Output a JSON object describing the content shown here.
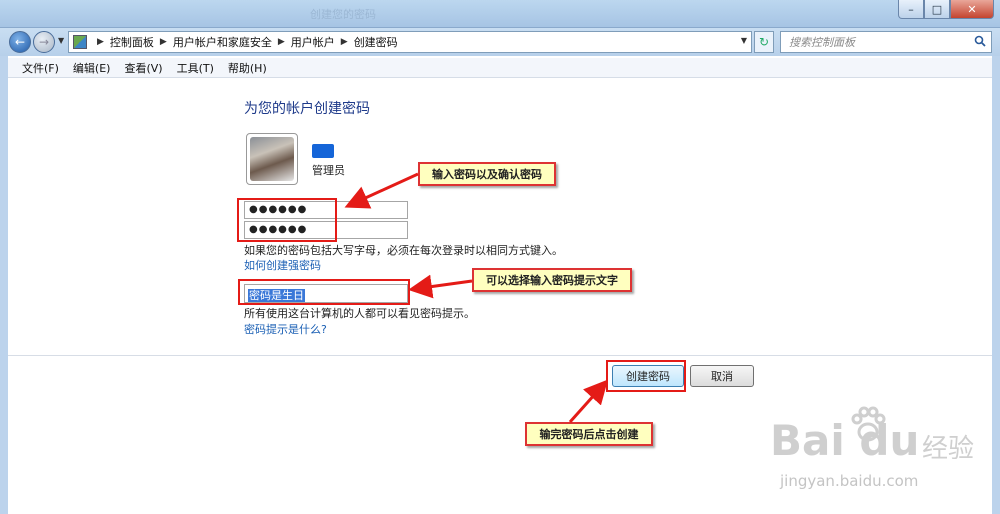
{
  "window": {
    "title": "创建您的密码"
  },
  "address": {
    "crumbs": [
      "控制面板",
      "用户帐户和家庭安全",
      "用户帐户",
      "创建密码"
    ],
    "search_placeholder": "搜索控制面板"
  },
  "menu": [
    "文件(F)",
    "编辑(E)",
    "查看(V)",
    "工具(T)",
    "帮助(H)"
  ],
  "page": {
    "heading": "为您的帐户创建密码",
    "username": "管理员",
    "password": "●●●●●●",
    "confirm_password": "●●●●●●",
    "caps_note": "如果您的密码包括大写字母，必须在每次登录时以相同方式键入。",
    "strong_link": "如何创建强密码",
    "hint_value": "密码是生日",
    "hint_note": "所有使用这台计算机的人都可以看见密码提示。",
    "hint_link": "密码提示是什么?"
  },
  "buttons": {
    "create": "创建密码",
    "cancel": "取消"
  },
  "annotations": {
    "password_tip": "输入密码以及确认密码",
    "hint_tip": "可以选择输入密码提示文字",
    "create_tip": "输完密码后点击创建"
  },
  "watermark": {
    "brand": "Bai  du",
    "cn": "经验",
    "url": "jingyan.baidu.com"
  },
  "colors": {
    "annotation_red": "#e41b17",
    "callout_bg": "#ffffbf",
    "link": "#1a5fb4",
    "heading": "#1e3a8a"
  }
}
